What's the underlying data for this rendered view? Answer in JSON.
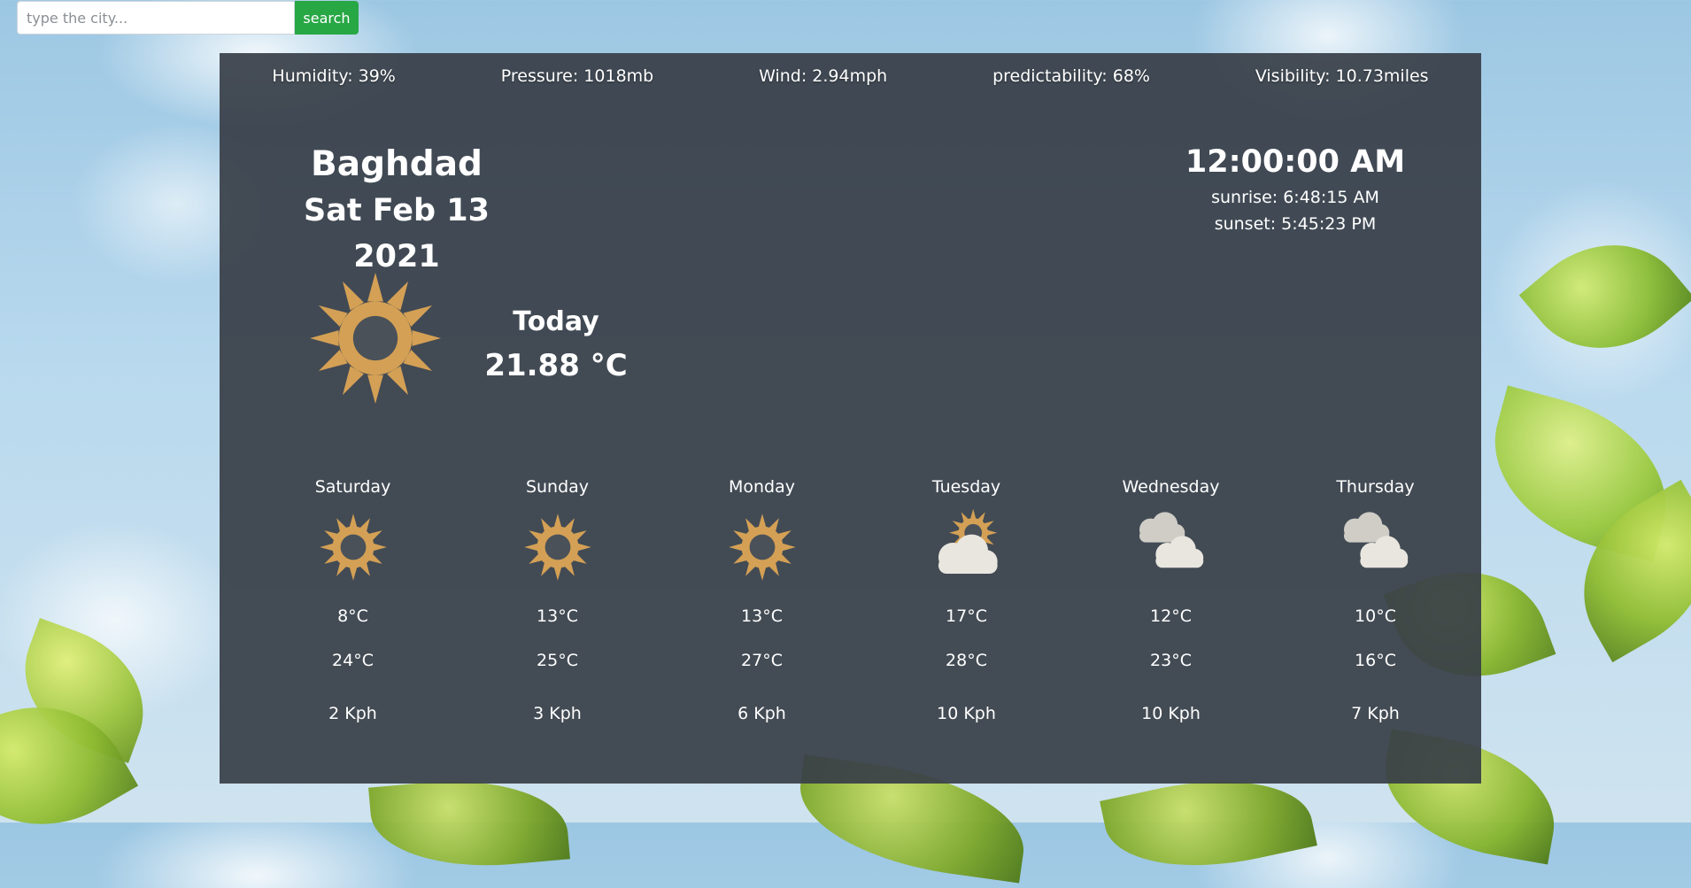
{
  "search": {
    "placeholder": "type the city...",
    "button_label": "search"
  },
  "stats": {
    "humidity": "Humidity: 39%",
    "pressure": "Pressure: 1018mb",
    "wind": "Wind: 2.94mph",
    "predictability": "predictability: 68%",
    "visibility": "Visibility: 10.73miles"
  },
  "location": {
    "city": "Baghdad",
    "date": "Sat Feb 13 2021"
  },
  "time": {
    "clock": "12:00:00 AM",
    "sunrise": "sunrise: 6:48:15 AM",
    "sunset": "sunset: 5:45:23 PM"
  },
  "today": {
    "label": "Today",
    "temp": "21.88 °C",
    "icon": "sun-icon"
  },
  "forecast": [
    {
      "day": "Saturday",
      "min": "8°C",
      "max": "24°C",
      "wind": "2 Kph",
      "icon": "sun-icon"
    },
    {
      "day": "Sunday",
      "min": "13°C",
      "max": "25°C",
      "wind": "3 Kph",
      "icon": "sun-icon"
    },
    {
      "day": "Monday",
      "min": "13°C",
      "max": "27°C",
      "wind": "6 Kph",
      "icon": "sun-icon"
    },
    {
      "day": "Tuesday",
      "min": "17°C",
      "max": "28°C",
      "wind": "10 Kph",
      "icon": "partly-cloudy-icon"
    },
    {
      "day": "Wednesday",
      "min": "12°C",
      "max": "23°C",
      "wind": "10 Kph",
      "icon": "clouds-icon"
    },
    {
      "day": "Thursday",
      "min": "10°C",
      "max": "16°C",
      "wind": "7 Kph",
      "icon": "clouds-icon"
    }
  ],
  "colors": {
    "sun": "#d4a055",
    "cloud": "#e8e6df",
    "button": "#28a745",
    "panel": "#373e46"
  }
}
